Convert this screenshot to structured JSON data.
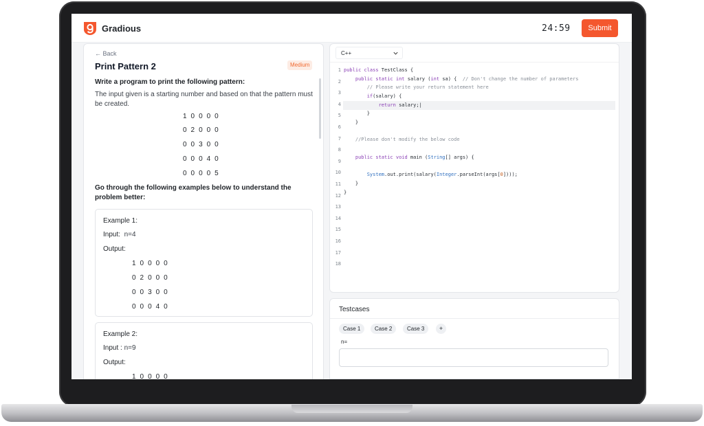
{
  "app": {
    "name": "Gradious",
    "timer": "24:59",
    "submit_label": "Submit"
  },
  "problem": {
    "back_label": "Back",
    "title": "Print Pattern 2",
    "difficulty": "Medium",
    "prompt": "Write a program to print the following pattern:",
    "description": "The input given is a starting number and based on that the pattern must be created.",
    "pattern": [
      "1 0 0 0 0",
      "0 2 0 0 0",
      "0 0 3 0 0",
      "0 0 0 4 0",
      "0 0 0 0 5"
    ],
    "hint": "Go through the following examples below to understand the problem better:"
  },
  "examples": [
    {
      "title": "Example 1:",
      "input_label": "Input:",
      "input_value": "n=4",
      "output_label": "Output:",
      "output": [
        "1 0 0 0 0",
        "0 2 0 0 0",
        "0 0 3 0 0",
        "0 0 0 4 0"
      ]
    },
    {
      "title": "Example 2:",
      "input_label": "Input :",
      "input_value": "n=9",
      "output_label": "Output:",
      "output": [
        "1 0 0 0 0"
      ]
    }
  ],
  "editor": {
    "language": "C++",
    "line_numbers": [
      "1",
      "2",
      "3",
      "4",
      "5",
      "6",
      "7",
      "8",
      "9",
      "10",
      "11",
      "12",
      "13",
      "14",
      "15",
      "16",
      "17",
      "18"
    ]
  },
  "testcases": {
    "header": "Testcases",
    "cases": [
      "Case 1",
      "Case 2",
      "Case 3"
    ],
    "add_label": "+",
    "input_label": "n=",
    "input_value": ""
  },
  "icons": {
    "logo": "gradious-logo-icon",
    "back": "arrow-left-icon",
    "language": "chevron-down-icon"
  },
  "colors": {
    "accent": "#f4572e",
    "badge_bg": "#fdece4",
    "badge_text": "#f06a32"
  }
}
